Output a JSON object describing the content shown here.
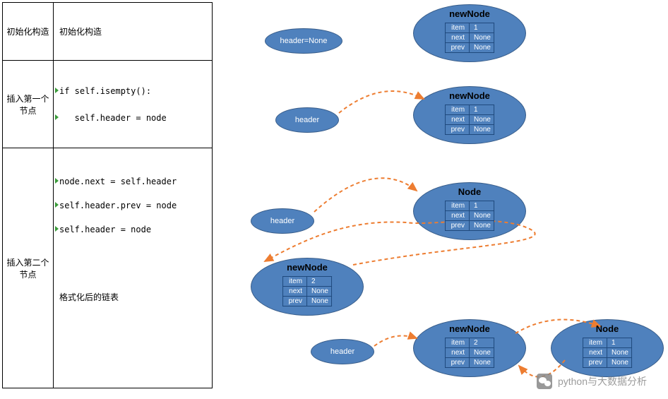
{
  "rows": {
    "r1_label": "初始化构造",
    "r1_desc": "初始化构造",
    "r2_label": "插入第一个节点",
    "r2_code1": "if self.isempty():",
    "r2_code2": "   self.header = node",
    "r3_label": "插入第二个节点",
    "r3_code1": "node.next = self.header",
    "r3_code2": "self.header.prev = node",
    "r3_code3": "self.header = node",
    "r3_desc": "格式化后的链表"
  },
  "labels": {
    "header_none": "header=None",
    "header": "header",
    "newNode": "newNode",
    "Node": "Node"
  },
  "fields": {
    "item": "item",
    "next": "next",
    "prev": "prev",
    "none": "None",
    "v1": "1",
    "v2": "2"
  },
  "watermark": "python与大数据分析",
  "chart_data": {
    "type": "diagram",
    "title": "Doubly Linked List Insertion at Head",
    "stages": [
      {
        "label": "初始化构造",
        "header": "None",
        "nodes": [
          {
            "name": "newNode",
            "item": 1,
            "next": "None",
            "prev": "None"
          }
        ]
      },
      {
        "label": "插入第一个节点",
        "code": [
          "if self.isempty():",
          "self.header = node"
        ],
        "header": "newNode",
        "nodes": [
          {
            "name": "newNode",
            "item": 1,
            "next": "None",
            "prev": "None"
          }
        ],
        "arrows": [
          [
            "header",
            "newNode"
          ]
        ]
      },
      {
        "label": "插入第二个节点",
        "code": [
          "node.next = self.header",
          "self.header.prev = node",
          "self.header = node"
        ],
        "header": "newNode",
        "nodes": [
          {
            "name": "Node",
            "item": 1,
            "next": "None",
            "prev": "None"
          },
          {
            "name": "newNode",
            "item": 2,
            "next": "None",
            "prev": "None"
          }
        ],
        "arrows": [
          [
            "header",
            "Node"
          ],
          [
            "newNode.next",
            "Node"
          ],
          [
            "Node.prev",
            "newNode"
          ]
        ]
      },
      {
        "label": "格式化后的链表",
        "header": "newNode",
        "nodes": [
          {
            "name": "newNode",
            "item": 2,
            "next": "None",
            "prev": "None"
          },
          {
            "name": "Node",
            "item": 1,
            "next": "None",
            "prev": "None"
          }
        ],
        "arrows": [
          [
            "header",
            "newNode"
          ],
          [
            "newNode.next",
            "Node"
          ],
          [
            "Node.prev",
            "newNode"
          ]
        ]
      }
    ]
  }
}
